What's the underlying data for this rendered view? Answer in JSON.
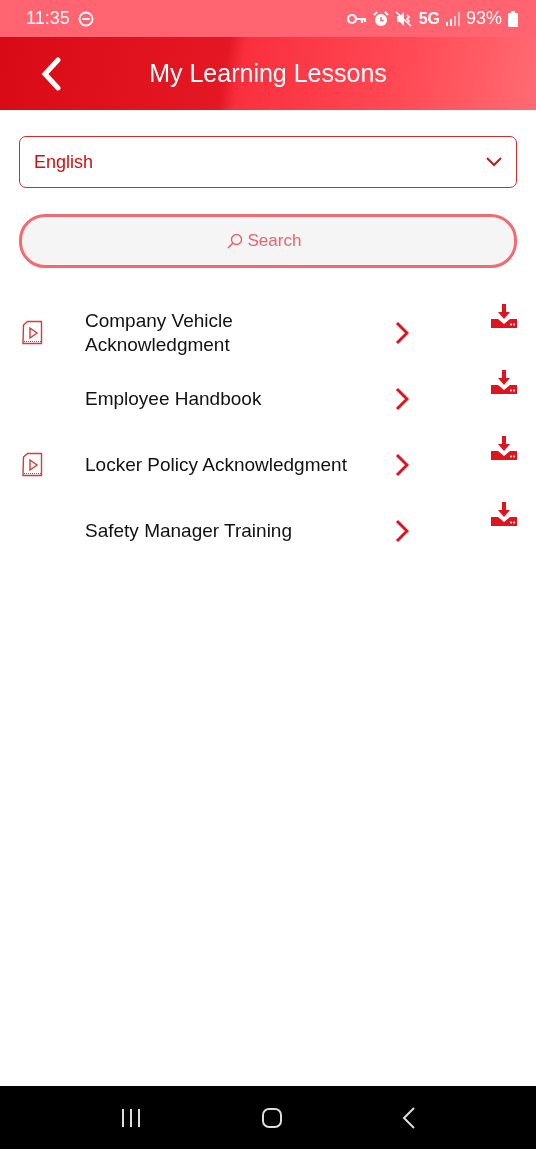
{
  "status_bar": {
    "time": "11:35",
    "network": "5G",
    "battery": "93%"
  },
  "header": {
    "title": "My Learning Lessons"
  },
  "language_select": {
    "value": "English"
  },
  "search": {
    "placeholder": "Search"
  },
  "lessons": [
    {
      "title": "Company Vehicle Acknowledgment",
      "has_video": true
    },
    {
      "title": "Employee Handbook",
      "has_video": false
    },
    {
      "title": "Locker Policy Acknowledgment",
      "has_video": true
    },
    {
      "title": "Safety Manager Training",
      "has_video": false
    }
  ]
}
